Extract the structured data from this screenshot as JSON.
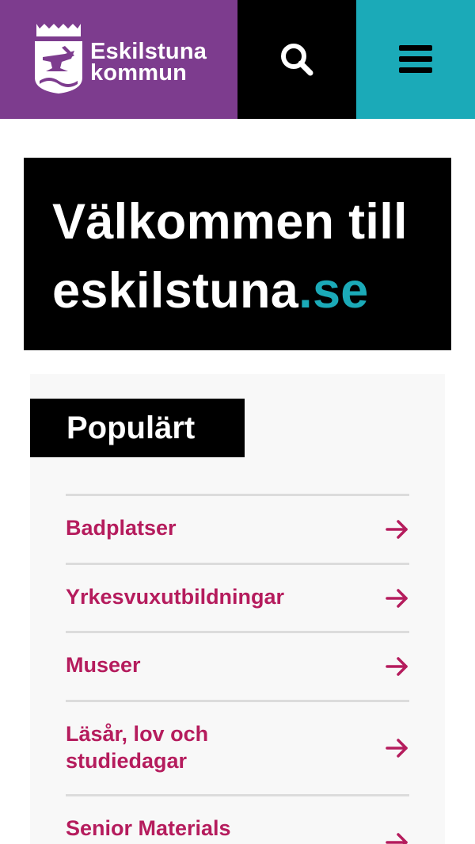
{
  "header": {
    "logo_line1": "Eskilstuna",
    "logo_line2": "kommun",
    "search_icon": "search-icon",
    "menu_icon": "hamburger-menu-icon",
    "colors": {
      "logo_bg": "#7d3c8e",
      "search_bg": "#000000",
      "menu_bg": "#1baab8"
    }
  },
  "hero": {
    "title_prefix": "Välkommen till eskilstuna",
    "title_suffix": ".se",
    "accent_color": "#1baab8"
  },
  "popular": {
    "heading": "Populärt",
    "link_color": "#b51c5d",
    "arrow_icon": "arrow-right-icon",
    "items": [
      {
        "label": "Badplatser"
      },
      {
        "label": "Yrkesvuxutbildningar"
      },
      {
        "label": "Museer"
      },
      {
        "label": "Läsår, lov och studiedagar"
      },
      {
        "label": "Senior Materials"
      }
    ]
  }
}
